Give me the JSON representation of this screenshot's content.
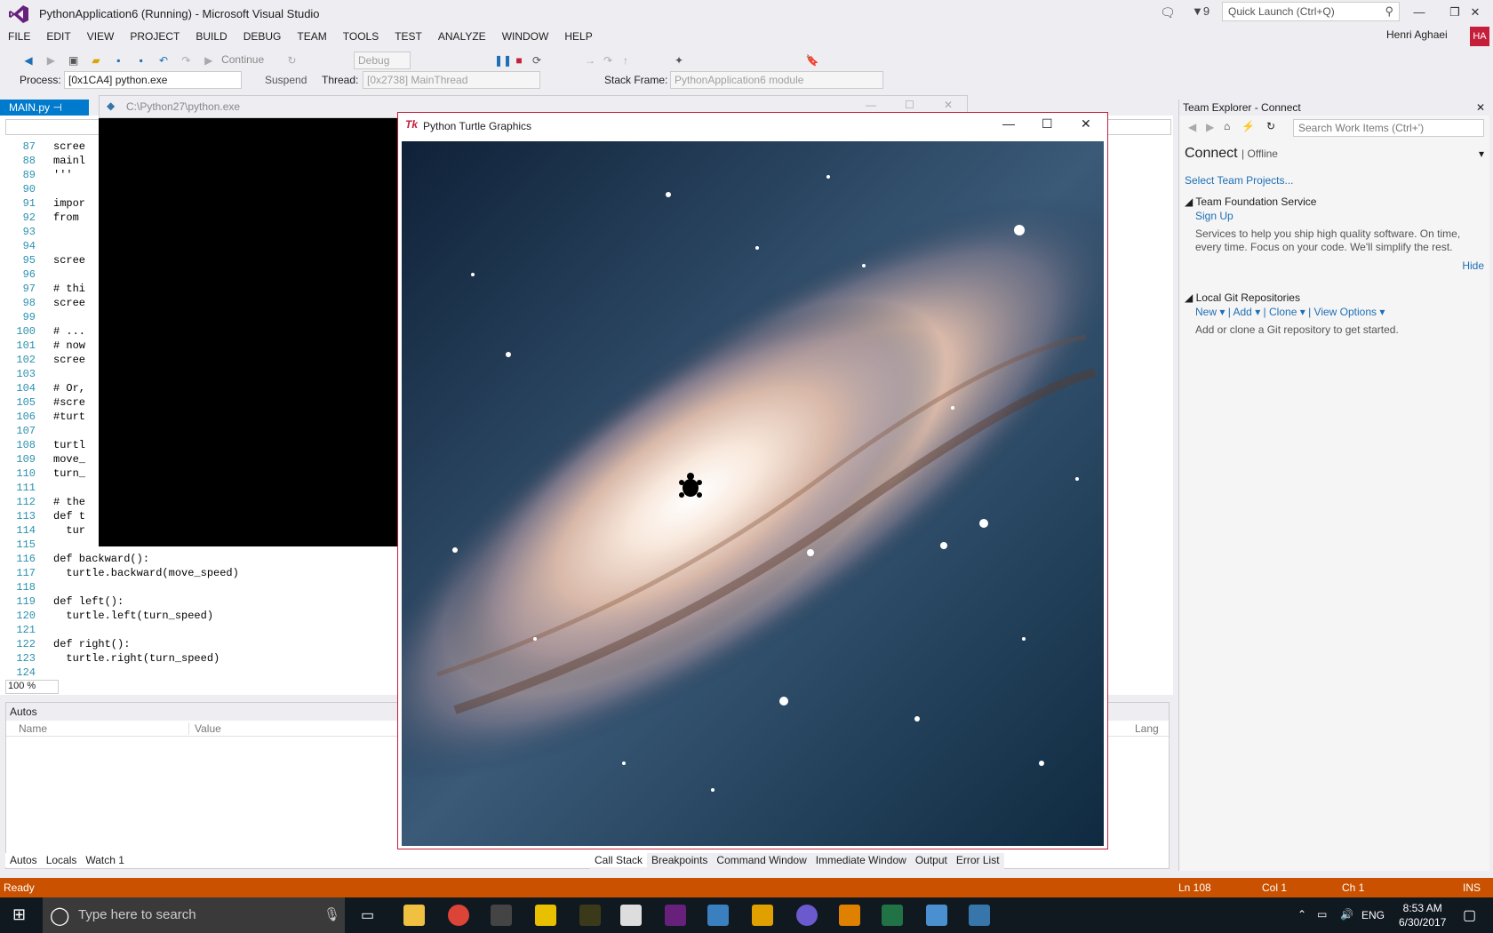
{
  "window": {
    "title": "PythonApplication6 (Running) - Microsoft Visual Studio",
    "notifications_count": "9",
    "quick_launch_placeholder": "Quick Launch (Ctrl+Q)",
    "user_name": "Henri Aghaei",
    "user_initials": "HA"
  },
  "menu": [
    "FILE",
    "EDIT",
    "VIEW",
    "PROJECT",
    "BUILD",
    "DEBUG",
    "TEAM",
    "TOOLS",
    "TEST",
    "ANALYZE",
    "WINDOW",
    "HELP"
  ],
  "toolbar": {
    "continue_label": "Continue",
    "config_value": "Debug"
  },
  "debug_location": {
    "process_label": "Process:",
    "process_value": "[0x1CA4] python.exe",
    "suspend_label": "Suspend",
    "thread_label": "Thread:",
    "thread_value": "[0x2738] MainThread",
    "stack_frame_label": "Stack Frame:",
    "stack_frame_value": "PythonApplication6 module"
  },
  "editor": {
    "tab_label": "MAIN.py",
    "zoom": "100 %",
    "lines": [
      {
        "n": "87",
        "t": "scree"
      },
      {
        "n": "88",
        "t": "mainl"
      },
      {
        "n": "89",
        "t": "'''"
      },
      {
        "n": "90",
        "t": ""
      },
      {
        "n": "91",
        "t": "impor"
      },
      {
        "n": "92",
        "t": "from"
      },
      {
        "n": "93",
        "t": ""
      },
      {
        "n": "94",
        "t": ""
      },
      {
        "n": "95",
        "t": "scree"
      },
      {
        "n": "96",
        "t": ""
      },
      {
        "n": "97",
        "t": "# thi"
      },
      {
        "n": "98",
        "t": "scree"
      },
      {
        "n": "99",
        "t": ""
      },
      {
        "n": "100",
        "t": "# ..."
      },
      {
        "n": "101",
        "t": "# now"
      },
      {
        "n": "102",
        "t": "scree"
      },
      {
        "n": "103",
        "t": ""
      },
      {
        "n": "104",
        "t": "# Or,"
      },
      {
        "n": "105",
        "t": "#scre"
      },
      {
        "n": "106",
        "t": "#turt"
      },
      {
        "n": "107",
        "t": ""
      },
      {
        "n": "108",
        "t": "turtl"
      },
      {
        "n": "109",
        "t": "move_"
      },
      {
        "n": "110",
        "t": "turn_"
      },
      {
        "n": "111",
        "t": ""
      },
      {
        "n": "112",
        "t": "# the"
      },
      {
        "n": "113",
        "t": "def t"
      },
      {
        "n": "114",
        "t": "  tur"
      },
      {
        "n": "115",
        "t": ""
      },
      {
        "n": "116",
        "t": "def backward():"
      },
      {
        "n": "117",
        "t": "  turtle.backward(move_speed)"
      },
      {
        "n": "118",
        "t": ""
      },
      {
        "n": "119",
        "t": "def left():"
      },
      {
        "n": "120",
        "t": "  turtle.left(turn_speed)"
      },
      {
        "n": "121",
        "t": ""
      },
      {
        "n": "122",
        "t": "def right():"
      },
      {
        "n": "123",
        "t": "  turtle.right(turn_speed)"
      },
      {
        "n": "124",
        "t": ""
      }
    ]
  },
  "console": {
    "title": "C:\\Python27\\python.exe"
  },
  "turtle_window": {
    "title": "Python Turtle Graphics"
  },
  "autos": {
    "title": "Autos",
    "col_name": "Name",
    "col_value": "Value",
    "col_lang": "Lang",
    "tabs": [
      "Autos",
      "Locals",
      "Watch 1"
    ],
    "right_tabs": [
      "Call Stack",
      "Breakpoints",
      "Command Window",
      "Immediate Window",
      "Output",
      "Error List"
    ]
  },
  "team_explorer": {
    "title": "Team Explorer - Connect",
    "search_placeholder": "Search Work Items (Ctrl+')",
    "connect": "Connect",
    "offline": "Offline",
    "select_projects": "Select Team Projects...",
    "tfs_header": "Team Foundation Service",
    "sign_up": "Sign Up",
    "tfs_desc": "Services to help you ship high quality software. On time, every time. Focus on your code. We'll simplify the rest.",
    "hide": "Hide",
    "git_header": "Local Git Repositories",
    "git_new": "New",
    "git_add": "Add",
    "git_clone": "Clone",
    "git_view": "View Options",
    "git_desc": "Add or clone a Git repository to get started."
  },
  "status": {
    "ready": "Ready",
    "ln": "Ln 108",
    "col": "Col 1",
    "ch": "Ch 1",
    "ins": "INS"
  },
  "taskbar": {
    "search_placeholder": "Type here to search",
    "lang": "ENG",
    "time": "8:53 AM",
    "date": "6/30/2017"
  }
}
